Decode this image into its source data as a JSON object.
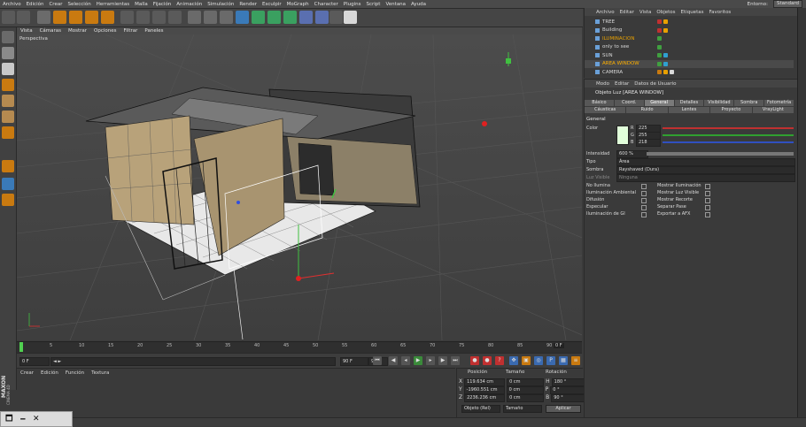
{
  "menubar": {
    "items": [
      "Archivo",
      "Edición",
      "Crear",
      "Selección",
      "Herramientas",
      "Malla",
      "Fijación",
      "Animación",
      "Simulación",
      "Render",
      "Esculpir",
      "MoGraph",
      "Character",
      "Plugins",
      "Script",
      "Ventana",
      "Ayuda"
    ],
    "layout_label": "Entorno:",
    "layout_value": "Standard"
  },
  "viewport": {
    "menu": [
      "Vista",
      "Cámaras",
      "Mostrar",
      "Opciones",
      "Filtrar",
      "Paneles"
    ],
    "label": "Perspectiva"
  },
  "timeline": {
    "frames": [
      "0",
      "5",
      "10",
      "15",
      "20",
      "25",
      "30",
      "35",
      "40",
      "45",
      "50",
      "55",
      "60",
      "65",
      "70",
      "75",
      "80",
      "85",
      "90"
    ],
    "current_frame": "0 F",
    "start_field": "0 F",
    "end_field": "90 F",
    "end_field2": "90 F",
    "arrows": "◄ ►"
  },
  "material": {
    "menu": [
      "Crear",
      "Edición",
      "Función",
      "Textura"
    ]
  },
  "coordinates": {
    "headers": [
      "Posición",
      "Tamaño",
      "Rotación"
    ],
    "rows": [
      {
        "axis": "X",
        "pos": "119.634 cm",
        "size": "0 cm",
        "rot_axis": "H",
        "rot": "180 °"
      },
      {
        "axis": "Y",
        "pos": "-1960.551 cm",
        "size": "0 cm",
        "rot_axis": "P",
        "rot": "0 °"
      },
      {
        "axis": "Z",
        "pos": "2236.236 cm",
        "size": "0 cm",
        "rot_axis": "B",
        "rot": "90 °"
      }
    ],
    "mode_select": "Objeto (Rel)",
    "size_select": "Tamaño",
    "apply_label": "Aplicar"
  },
  "object_manager": {
    "menu": [
      "Archivo",
      "Editar",
      "Vista",
      "Objetos",
      "Etiquetas",
      "Favoritos"
    ],
    "rows": [
      {
        "name": "TREE",
        "color": "#d8d8d8"
      },
      {
        "name": "Building",
        "color": "#d8d8d8"
      },
      {
        "name": "ILUMINACION",
        "color": "#e8a000"
      },
      {
        "name": "only to see",
        "color": "#d8d8d8"
      },
      {
        "name": "SUN",
        "color": "#d8d8d8"
      },
      {
        "name": "AREA WINDOW",
        "color": "#ffb000"
      },
      {
        "name": "CAMERA",
        "color": "#d8d8d8"
      }
    ]
  },
  "attributes": {
    "menu": [
      "Modo",
      "Editar",
      "Datos de Usuario"
    ],
    "object_title": "Objeto Luz [AREA WINDOW]",
    "tabs_row1": [
      "Básico",
      "Coord.",
      "General",
      "Detalles",
      "Visibilidad",
      "Sombra",
      "Fotometría"
    ],
    "tabs_row2": [
      "Cáusticas",
      "Ruido",
      "Lentes",
      "Proyecto",
      "VrayLight"
    ],
    "active_tab": "General",
    "section": "General",
    "color_label": "Color",
    "rgb": [
      {
        "ch": "R",
        "val": "225"
      },
      {
        "ch": "G",
        "val": "255"
      },
      {
        "ch": "B",
        "val": "218"
      }
    ],
    "intensity_label": "Intensidad",
    "intensity_value": "600 %",
    "type_label": "Tipo",
    "type_value": "Área",
    "shadow_label": "Sombra",
    "shadow_value": "Rayshaved (Dura)",
    "visible_light_label": "Luz Visible",
    "visible_light_value": "Ninguna",
    "checks_left": [
      "No Ilumina",
      "Iluminación Ambiental",
      "Difusión",
      "Especular",
      "Iluminación de GI"
    ],
    "checks_right": [
      "Mostrar Iluminación",
      "Mostrar Luz Visible",
      "Mostrar Recorte",
      "Separar Pase",
      "Exportar a AFX"
    ],
    "color_swatch": "#e1ffda"
  },
  "logo": {
    "line1": "MAXON",
    "line2": "CINEMA 4D"
  },
  "colors": {
    "accent": "#f0a000",
    "selected": "#ffb000"
  },
  "window_buttons": [
    "🗖",
    "🗕",
    "✕"
  ]
}
